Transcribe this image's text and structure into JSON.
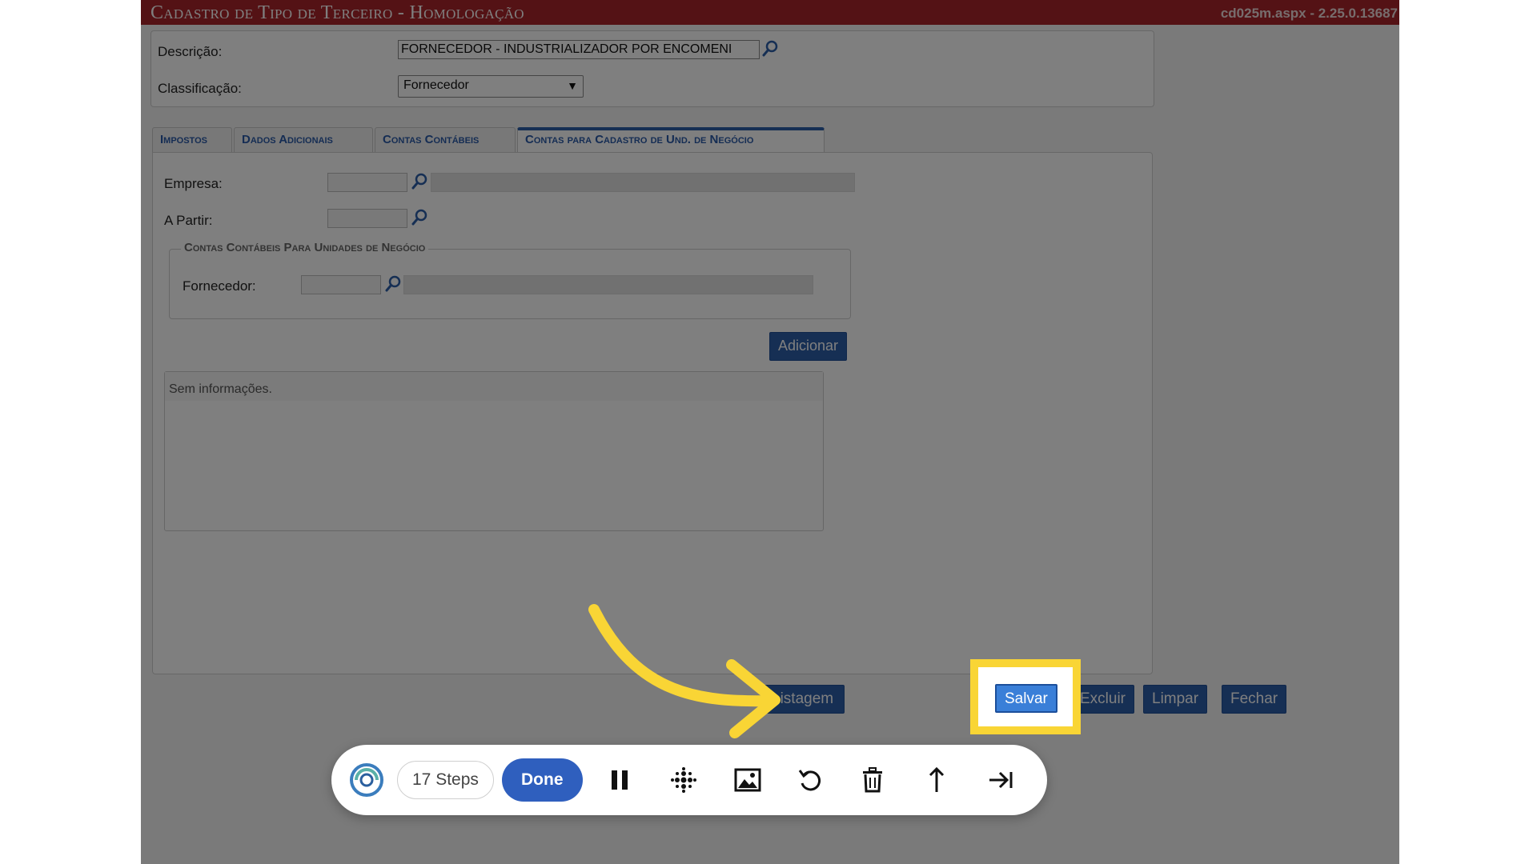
{
  "header": {
    "title": "Cadastro de Tipo de Terceiro  - Homologação",
    "version": "cd025m.aspx - 2.25.0.13687"
  },
  "form": {
    "descricao_label": "Descrição:",
    "descricao_value": "FORNECEDOR - INDUSTRIALIZADOR POR ENCOMENI",
    "classificacao_label": "Classificação:",
    "classificacao_value": "Fornecedor"
  },
  "tabs": [
    {
      "label": "Impostos",
      "active": false
    },
    {
      "label": "Dados Adicionais",
      "active": false
    },
    {
      "label": "Contas Contábeis",
      "active": false
    },
    {
      "label": "Contas para Cadastro de Und. de Negócio",
      "active": true
    }
  ],
  "tab_content": {
    "empresa_label": "Empresa:",
    "a_partir_label": "A Partir:",
    "fieldset_legend": "Contas Contábeis Para Unidades de Negócio",
    "fornecedor_label": "Fornecedor:",
    "adicionar_label": "Adicionar",
    "grid_empty": "Sem informações."
  },
  "actions": {
    "listagem": "Listagem",
    "salvar": "Salvar",
    "excluir": "Excluir",
    "limpar": "Limpar",
    "fechar": "Fechar"
  },
  "recorder": {
    "steps": "17 Steps",
    "done": "Done",
    "icons": [
      "logo-icon",
      "pause-icon",
      "blur-icon",
      "image-icon",
      "undo-icon",
      "trash-icon",
      "upload-icon",
      "skip-icon"
    ]
  },
  "colors": {
    "title_bar": "#a8252b",
    "button_blue": "#2c5ea8",
    "highlight_yellow": "#f9d535",
    "done_blue": "#2f5fbe"
  }
}
